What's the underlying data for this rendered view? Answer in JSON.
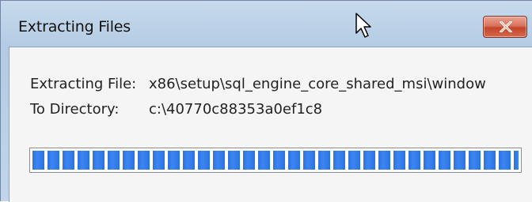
{
  "window": {
    "title": "Extracting Files"
  },
  "labels": {
    "extracting_file": "Extracting File:",
    "to_directory": "To Directory:"
  },
  "values": {
    "extracting_file": "x86\\setup\\sql_engine_core_shared_msi\\window",
    "to_directory": "c:\\40770c88353a0ef1c8"
  },
  "progress": {
    "fraction": 1.0
  },
  "icons": {
    "close": "close-icon",
    "cursor": "mouse-pointer-icon"
  },
  "colors": {
    "progress_fill": "#2b72e0",
    "close_button": "#c3452a",
    "titlebar": "#b3cbe3"
  }
}
